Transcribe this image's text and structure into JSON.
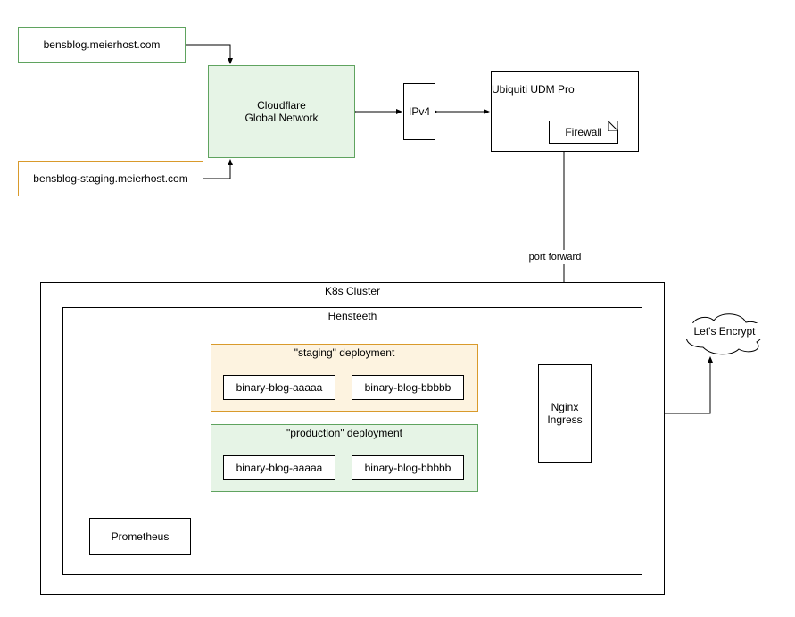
{
  "domains": {
    "prod": "bensblog.meierhost.com",
    "staging": "bensblog-staging.meierhost.com"
  },
  "cloud": {
    "cf": "Cloudflare\nGlobal Network",
    "ip": "IPv4",
    "udm": "Ubiquiti UDM Pro",
    "firewall": "Firewall",
    "port_fwd_label": "port forward",
    "lets_encrypt": "Let's Encrypt"
  },
  "cluster": {
    "title": "K8s Cluster",
    "node": "Hensteeth",
    "staging_title": "\"staging\" deployment",
    "prod_title": "\"production\" deployment",
    "pod_a": "binary-blog-aaaaa",
    "pod_b": "binary-blog-bbbbb",
    "ingress": "Nginx\nIngress",
    "prometheus": "Prometheus"
  }
}
